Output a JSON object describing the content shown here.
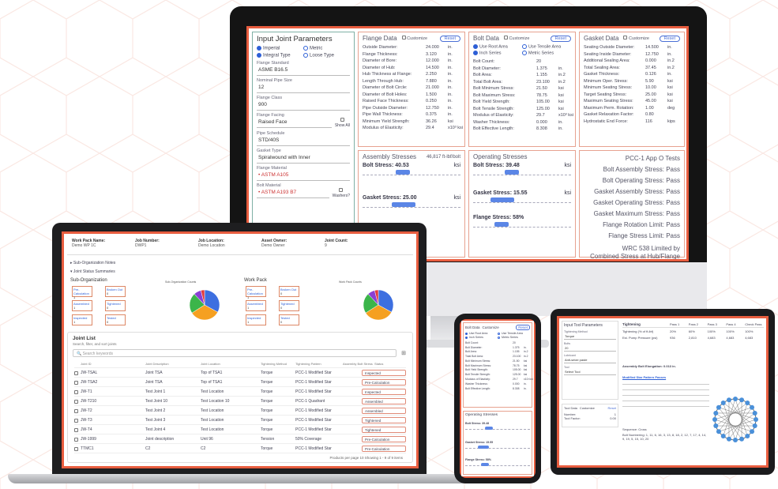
{
  "colors": {
    "accent": "#e85d3f",
    "blue": "#2d5fd6",
    "pie_green": "#3bb54a",
    "pie_orange": "#f5a021",
    "pie_blue": "#3d6fe0",
    "pie_purple": "#8a3fd4",
    "pie_red": "#e33b3b"
  },
  "joint": {
    "title": "Input Joint Parameters",
    "radios": [
      "Imperial",
      "Metric",
      "Integral Type",
      "Loose Type"
    ],
    "flange_standard_label": "Flange Standard",
    "flange_standard": "ASME B16.5",
    "nps_label": "Nominal Pipe Size",
    "nps": "12",
    "class_label": "Flange Class",
    "class": "900",
    "facing_label": "Flange Facing",
    "facing": "Raised Face",
    "show_all": "Show All",
    "schedule_label": "Pipe Schedule",
    "schedule": "STD/40S",
    "gasket_label": "Gasket Type",
    "gasket": "Spiralwound with Inner",
    "material_label": "Flange Material",
    "material": "• ASTM A105",
    "bolt_label": "Bolt Material",
    "bolt": "• ASTM A193 B7",
    "washers": "Washers?"
  },
  "flange": {
    "title": "Flange Data",
    "customize": "Customize",
    "reset": "Reset",
    "rows": [
      [
        "Outside Diameter:",
        "24.000",
        "in."
      ],
      [
        "Flange Thickness:",
        "3.120",
        "in."
      ],
      [
        "Diameter of Bore:",
        "12.000",
        "in."
      ],
      [
        "Diameter of Hub:",
        "14.500",
        "in."
      ],
      [
        "Hub Thickness at Flange:",
        "2.250",
        "in."
      ],
      [
        "Length Through Hub:",
        "7.880",
        "in."
      ],
      [
        "Diameter of Bolt Circle:",
        "21.000",
        "in."
      ],
      [
        "Diameter of Bolt Holes:",
        "1.500",
        "in."
      ],
      [
        "Raised Face Thickness:",
        "0.250",
        "in."
      ],
      [
        "Pipe Outside Diameter:",
        "12.750",
        "in."
      ],
      [
        "Pipe Wall Thickness:",
        "0.375",
        "in."
      ],
      [
        "Minimum Yield Strength:",
        "36.26",
        "ksi"
      ],
      [
        "Modulus of Elasticity:",
        "29.4",
        "x10³ ksi"
      ]
    ]
  },
  "bolt": {
    "title": "Bolt Data",
    "customize": "Customize",
    "reset": "Reset",
    "opts": [
      "Use Root Area",
      "Use Tensile Area",
      "Inch Series",
      "Metric Series"
    ],
    "rows": [
      [
        "Bolt Count:",
        "20",
        ""
      ],
      [
        "Bolt Diameter:",
        "1.375",
        "in."
      ],
      [
        "Bolt Area:",
        "1.155",
        "in.2"
      ],
      [
        "Total Bolt Area:",
        "23.100",
        "in.2"
      ],
      [
        "Bolt Minimum Stress:",
        "21.50",
        "ksi"
      ],
      [
        "Bolt Maximum Stress:",
        "78.75",
        "ksi"
      ],
      [
        "Bolt Yield Strength:",
        "105.00",
        "ksi"
      ],
      [
        "Bolt Tensile Strength:",
        "125.00",
        "ksi"
      ],
      [
        "Modulus of Elasticity:",
        "29.7",
        "x10³ ksi"
      ],
      [
        "Washer Thickness:",
        "0.000",
        "in."
      ],
      [
        "Bolt Effective Length:",
        "8.308",
        "in."
      ]
    ]
  },
  "gasket": {
    "title": "Gasket Data",
    "customize": "Customize",
    "reset": "Reset",
    "rows": [
      [
        "Seating Outside Diameter:",
        "14.500",
        "in."
      ],
      [
        "Seating Inside Diameter:",
        "12.750",
        "in."
      ],
      [
        "Additional Sealing Area:",
        "0.000",
        "in.2"
      ],
      [
        "Total Sealing Area:",
        "37.45",
        "in.2"
      ],
      [
        "Gasket Thickness:",
        "0.126",
        "in."
      ],
      [
        "Minimum Oper. Stress:",
        "5.90",
        "ksi"
      ],
      [
        "Minimum Seating Stress:",
        "10.00",
        "ksi"
      ],
      [
        "Target Seating Stress:",
        "25.00",
        "ksi"
      ],
      [
        "Maximum Seating Stress:",
        "45.00",
        "ksi"
      ],
      [
        "Maximum Perm. Rotation:",
        "1.00",
        "deg"
      ],
      [
        "Gasket Relaxation Factor:",
        "0.80",
        ""
      ],
      [
        "Hydrostatic End Force:",
        "116",
        "kips"
      ]
    ]
  },
  "assembly": {
    "title": "Assembly Stresses",
    "torque": "46,817 ft-lbf/bolt",
    "bolt": "Bolt Stress: 40.53",
    "bolt_unit": "ksi",
    "gasket": "Gasket Stress: 25.00",
    "gasket_unit": "ksi"
  },
  "operating": {
    "title": "Operating Stresses",
    "bolt": "Bolt Stress: 39.48",
    "bolt_unit": "ksi",
    "gasket": "Gasket Stress: 15.55",
    "gasket_unit": "ksi",
    "flange": "Flange Stress: 58%"
  },
  "pcc": {
    "title": "PCC-1 App O Tests",
    "lines": [
      "Bolt Assembly Stress: Pass",
      "Bolt Operating Stress: Pass",
      "Gasket Assembly Stress: Pass",
      "Gasket Operating Stress: Pass",
      "Gasket Maximum Stress: Pass",
      "Flange Rotation Limit: Pass",
      "Flange Stress Limit: Pass"
    ],
    "foot1": "WRC 538 Limited by",
    "foot2": "Combined Stress at Hub/Flange"
  },
  "laptop": {
    "headers": [
      [
        "Work Pack Name:",
        "Demo WP 1C"
      ],
      [
        "Job Number:",
        "DWP1"
      ],
      [
        "Job Location:",
        "Demo Location"
      ],
      [
        "Asset Owner:",
        "Demo Owner"
      ],
      [
        "Joint Count:",
        "9"
      ]
    ],
    "sub_notes": "Sub-Organization Notes",
    "status_summ": "Joint Status Summaries",
    "suborg": "Sub-Organization",
    "workpack": "Work Pack",
    "pie_title_a": "Sub-Organization Counts",
    "pie_title_b": "Work Pack Counts",
    "boxes": [
      "Pre-Calculation",
      "Broken Out",
      "Assembled",
      "Tightened",
      "Inspected",
      "Tested"
    ],
    "box_vals": [
      "1",
      "0",
      "1",
      "0",
      "1",
      "0"
    ],
    "joint_list": "Joint List",
    "joint_sub": "Search, filter, and sort joints",
    "search": "Search keywords",
    "cols": [
      "Joint ID",
      "Joint Description",
      "Joint Location",
      "Tightening Method",
      "Tightening Pattern",
      "Assembly Bolt Stress",
      "Status"
    ],
    "rows": [
      [
        "JW-TSAL",
        "Joint TSA",
        "Top of TSA1",
        "Torque",
        "PCC-1 Modified Star",
        "Inspected"
      ],
      [
        "JW-TSA2",
        "Joint TSA",
        "Top of TSA1",
        "Torque",
        "PCC-1 Modified Star",
        "Pre-Calculation"
      ],
      [
        "JW-T1",
        "Test Joint 1",
        "Test Location",
        "Torque",
        "PCC-1 Modified Star",
        "Inspected"
      ],
      [
        "JW-T210",
        "Test Joint 10",
        "Test Location 10",
        "Torque",
        "PCC-1 Quadrant",
        "Assembled"
      ],
      [
        "JW-T2",
        "Test Joint 2",
        "Test Location",
        "Torque",
        "PCC-1 Modified Star",
        "Assembled"
      ],
      [
        "JW-T3",
        "Test Joint 3",
        "Test Location",
        "Torque",
        "PCC-1 Modified Star",
        "Tightened"
      ],
      [
        "JW-T4",
        "Test Joint 4",
        "Test Location",
        "Torque",
        "PCC-1 Modified Star",
        "Tightened"
      ],
      [
        "JW-1999",
        "Joint description",
        "Unit 96",
        "Tension",
        "50% Coverage",
        "Pre-Calculation"
      ],
      [
        "TTMC1",
        "C2",
        "C2",
        "Torque",
        "PCC-1 Modified Star",
        "Pre-Calculation"
      ]
    ],
    "footer": "Products per page   10       Showing 1 - 9 of 9 items"
  },
  "phone": {
    "bolt_data": "Bolt Data",
    "customize": "Customize",
    "reset": "Reset",
    "opts": [
      "Use Root Area",
      "Use Tensile Area",
      "Inch Series",
      "Metric Series"
    ],
    "rows": [
      [
        "Bolt Count:",
        "20",
        ""
      ],
      [
        "Bolt Diameter:",
        "1.375",
        "in."
      ],
      [
        "Bolt Area:",
        "1.155",
        "in.2"
      ],
      [
        "Total Bolt Area:",
        "23.100",
        "in.2"
      ],
      [
        "Bolt Minimum Stress:",
        "21.50",
        "ksi"
      ],
      [
        "Bolt Maximum Stress:",
        "78.75",
        "ksi"
      ],
      [
        "Bolt Yield Strength:",
        "105.00",
        "ksi"
      ],
      [
        "Bolt Tensile Strength:",
        "125.00",
        "ksi"
      ],
      [
        "Modulus of Elasticity:",
        "29.7",
        "x10³ ksi"
      ],
      [
        "Washer Thickness:",
        "0.000",
        "in."
      ],
      [
        "Bolt Effective Length:",
        "8.308",
        "in."
      ]
    ],
    "oper": "Operating Stresses",
    "bolt": "Bolt Stress: 39.48",
    "gasket": "Gasket Stress: 15.55",
    "flange": "Flange Stress: 58%"
  },
  "tablet": {
    "title": "Input Tool Parameters",
    "f1l": "Tightening Method",
    "f1": "Torque",
    "f2l": "Bolts",
    "f2": "20",
    "f3l": "Lubricant",
    "f3": "Anti-seize paste",
    "f4l": "Tool",
    "f4": "Select Tool",
    "tool_data": "Tool Data",
    "customize": "Customize",
    "reset": "Reset",
    "t1": "Number:",
    "t1v": "1",
    "t2": "Tool Factor:",
    "t2v": "0.00",
    "tightening": "Tightening",
    "tcols": [
      "Pass 1",
      "Pass 2",
      "Pass 3",
      "Pass 4",
      "Check Pass"
    ],
    "tr1": "Tightening (% of ft-lbf)",
    "tr1v": [
      "20%",
      "60%",
      "100%",
      "100%",
      "100%"
    ],
    "tr2": "Est. Pump Pressure (psi)",
    "tr2v": [
      "936",
      "2,810",
      "4,683",
      "4,683",
      "4,683"
    ],
    "asm": "Assembly Bolt Elongation: 0.013 in.",
    "pattern": "Modified Star Pattern Passes",
    "sequence": "Sequence: Cross",
    "numbering": "Bolt Numbering: 1, 11, 6, 16, 3, 13, 8, 18, 2, 12, 7, 17, 4, 14, 9, 19, 5, 15, 10, 20"
  }
}
